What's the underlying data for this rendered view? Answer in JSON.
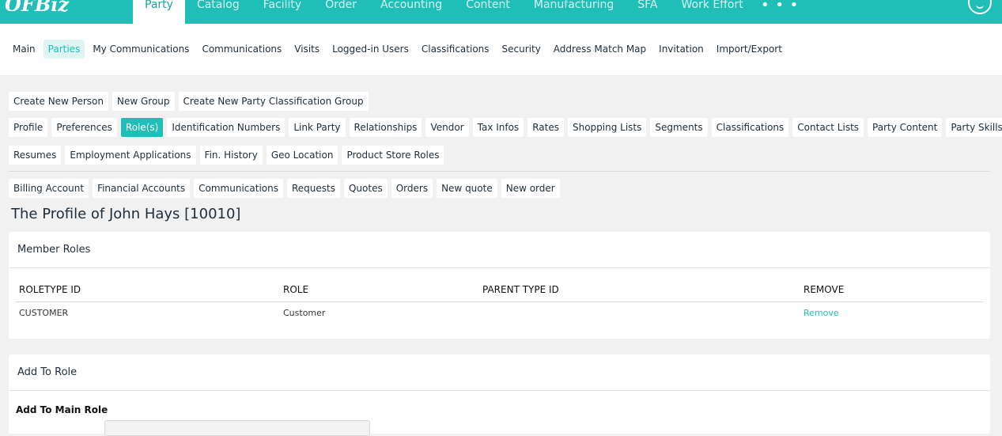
{
  "app": {
    "logo": "OFBiz"
  },
  "topnav": {
    "items": [
      "Party",
      "Catalog",
      "Facility",
      "Order",
      "Accounting",
      "Content",
      "Manufacturing",
      "SFA",
      "Work Effort"
    ],
    "active": "Party",
    "more": "• • •"
  },
  "subnav": {
    "items": [
      "Main",
      "Parties",
      "My Communications",
      "Communications",
      "Visits",
      "Logged-in Users",
      "Classifications",
      "Security",
      "Address Match Map",
      "Invitation",
      "Import/Export"
    ],
    "active": "Parties"
  },
  "actions_row": [
    "Create New Person",
    "New Group",
    "Create New Party Classification Group"
  ],
  "profile_tabs_row1": [
    "Profile",
    "Preferences",
    "Role(s)",
    "Identification Numbers",
    "Link Party",
    "Relationships",
    "Vendor",
    "Tax Infos",
    "Rates",
    "Shopping Lists",
    "Segments",
    "Classifications",
    "Contact Lists",
    "Party Content",
    "Party Skills"
  ],
  "profile_tabs_row2": [
    "Resumes",
    "Employment Applications",
    "Fin. History",
    "Geo Location",
    "Product Store Roles"
  ],
  "profile_tabs_selected": "Role(s)",
  "related_row": [
    "Billing Account",
    "Financial Accounts",
    "Communications",
    "Requests",
    "Quotes",
    "Orders",
    "New quote",
    "New order"
  ],
  "page": {
    "title": "The Profile of John Hays [10010]"
  },
  "member_roles": {
    "heading": "Member Roles",
    "columns": [
      "ROLETYPE ID",
      "ROLE",
      "PARENT TYPE ID",
      "REMOVE"
    ],
    "rows": [
      {
        "roletype_id": "CUSTOMER",
        "role": "Customer",
        "parent_type_id": "",
        "remove": "Remove"
      }
    ]
  },
  "add_to_role": {
    "heading": "Add To Role",
    "main_role_label": "Add To Main Role"
  }
}
